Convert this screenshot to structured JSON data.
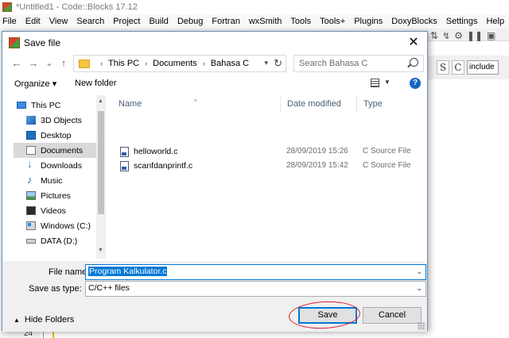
{
  "app": {
    "title": "*Untitled1 - Code::Blocks 17.12",
    "menu": [
      "File",
      "Edit",
      "View",
      "Search",
      "Project",
      "Build",
      "Debug",
      "Fortran",
      "wxSmith",
      "Tools",
      "Tools+",
      "Plugins",
      "DoxyBlocks",
      "Settings",
      "Help"
    ],
    "include_field": "include",
    "line_number": "24"
  },
  "dialog": {
    "title": "Save file",
    "close_glyph": "✕",
    "nav": {
      "back": "←",
      "forward": "→",
      "dropdown": "⌄",
      "up": "↑"
    },
    "address": [
      "This PC",
      "Documents",
      "Bahasa C"
    ],
    "address_sep": "›",
    "search_placeholder": "Search Bahasa C",
    "organize": "Organize ▾",
    "new_folder": "New folder",
    "help": "?",
    "nav_items": [
      {
        "label": "This PC",
        "icon": "computer-icon"
      },
      {
        "label": "3D Objects",
        "icon": "cube-icon"
      },
      {
        "label": "Desktop",
        "icon": "desktop-icon"
      },
      {
        "label": "Documents",
        "icon": "documents-icon",
        "selected": true
      },
      {
        "label": "Downloads",
        "icon": "download-icon"
      },
      {
        "label": "Music",
        "icon": "music-icon"
      },
      {
        "label": "Pictures",
        "icon": "pictures-icon"
      },
      {
        "label": "Videos",
        "icon": "videos-icon"
      },
      {
        "label": "Windows (C:)",
        "icon": "drive-icon"
      },
      {
        "label": "DATA (D:)",
        "icon": "drive-icon"
      }
    ],
    "columns": {
      "name": "Name",
      "date": "Date modified",
      "type": "Type"
    },
    "files": [
      {
        "name": "helloworld.c",
        "date": "28/09/2019 15:26",
        "type": "C Source File"
      },
      {
        "name": "scanfdanprintf.c",
        "date": "28/09/2019 15:42",
        "type": "C Source File"
      }
    ],
    "file_name_label": "File name:",
    "file_name_value": "Program Kalkulator.c",
    "save_type_label": "Save as type:",
    "save_type_value": "C/C++ files",
    "hide_folders": "Hide Folders",
    "save_button": "Save",
    "cancel_button": "Cancel"
  }
}
